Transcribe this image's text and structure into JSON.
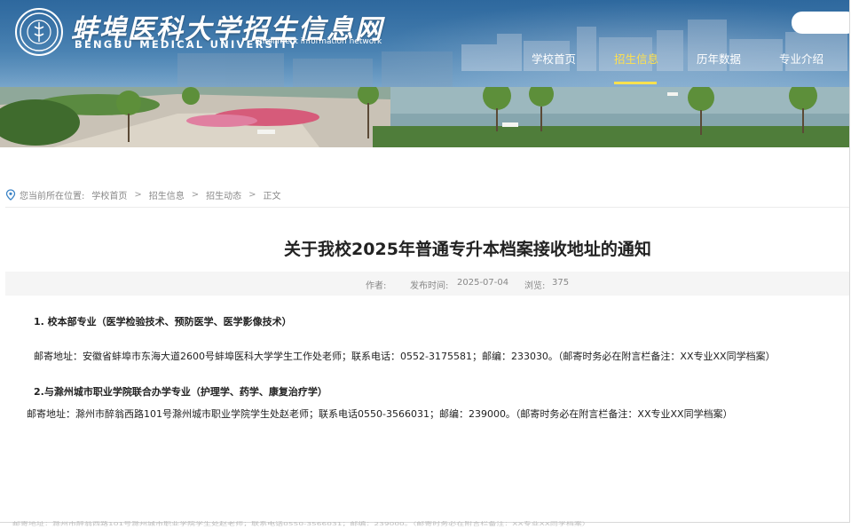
{
  "site": {
    "logo_cn": "蚌埠医科大学招生信息网",
    "logo_en": "BENGBU MEDICAL UNIVERSITY",
    "logo_en_sub": "Enrollment information network"
  },
  "search": {
    "placeholder": ""
  },
  "nav": {
    "items": [
      {
        "label": "学校首页"
      },
      {
        "label": "招生信息"
      },
      {
        "label": "历年数据"
      },
      {
        "label": "专业介绍"
      }
    ],
    "active_index": 1
  },
  "breadcrumb": {
    "prefix": "您当前所在位置:",
    "items": [
      "学校首页",
      "招生信息",
      "招生动态",
      "正文"
    ],
    "separator": ">"
  },
  "article": {
    "title": "关于我校2025年普通专升本档案接收地址的通知",
    "meta": {
      "author_label": "作者:",
      "author": "",
      "date_label": "发布时间:",
      "date": "2025-07-04",
      "views_label": "浏览:",
      "views": "375"
    },
    "paragraphs": [
      "1. 校本部专业（医学检验技术、预防医学、医学影像技术）",
      "邮寄地址：安徽省蚌埠市东海大道2600号蚌埠医科大学学生工作处老师；联系电话：0552-3175581；邮编：233030。（邮寄时务必在附言栏备注：XX专业XX同学档案）",
      "2.与滁州城市职业学院联合办学专业（护理学、药学、康复治疗学）",
      "邮寄地址：滁州市醉翁西路101号滁州城市职业学院学生处赵老师；联系电话0550-3566031；邮编：239000。（邮寄时务必在附言栏备注：XX专业XX同学档案）"
    ]
  },
  "colors": {
    "nav_active": "#ffe14d",
    "header_blue": "#3d7fb4",
    "meta_bg": "#f5f5f5"
  },
  "icons": {
    "logo": "university-seal-icon",
    "breadcrumb": "location-pin-icon"
  }
}
